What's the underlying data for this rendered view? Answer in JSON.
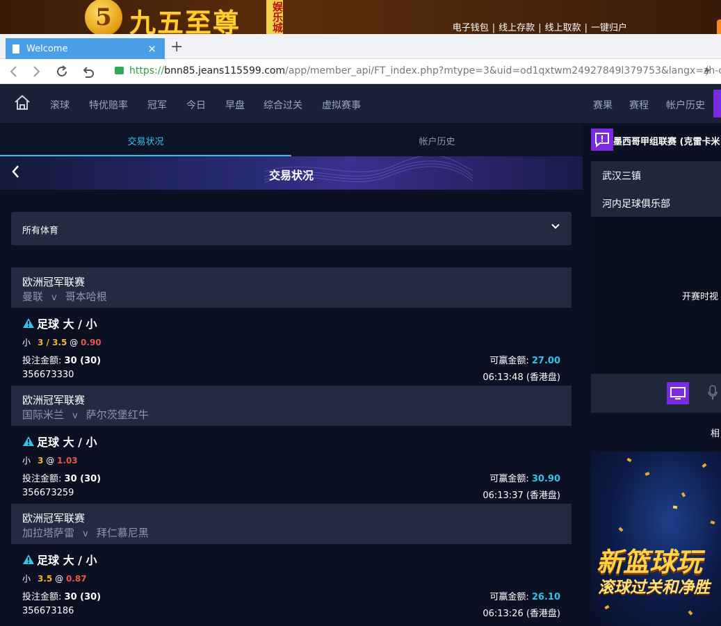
{
  "banner": {
    "logo_char": "5",
    "logo_text": "九五至尊",
    "logo_side": "娱乐城",
    "links": [
      "电子钱包",
      "线上存款",
      "线上取款",
      "一键归户"
    ],
    "separator": "|"
  },
  "browser": {
    "tab_title": "Welcome",
    "tab_close": "×",
    "new_tab": "+",
    "url_scheme": "https://",
    "url_host": "bnn85.jeans115599.com",
    "url_path": "/app/member_api/FT_index.php?mtype=3&uid=od1qxtwm24927849l379753&langx=zh-c"
  },
  "nav": {
    "items": [
      "滚球",
      "特优赔率",
      "冠军",
      "今日",
      "早盘",
      "综合过关",
      "虚拟赛事"
    ],
    "right_items": [
      "赛果",
      "赛程",
      "帐户历史"
    ]
  },
  "subtabs": {
    "active": "交易状况",
    "inactive": "帐户历史"
  },
  "page": {
    "back": "‹",
    "title": "交易状况"
  },
  "filter": {
    "label": "所有体育"
  },
  "bets": [
    {
      "league": "欧洲冠军联赛",
      "home": "曼联",
      "vs": "v",
      "away": "哥本哈根",
      "type": "足球 大 / 小",
      "side": "小",
      "handicap": "3 / 3.5",
      "at": "@",
      "odds": "0.90",
      "stake_label": "投注金额:",
      "stake": "30 (30)",
      "win_label": "可赢金额:",
      "win": "27.00",
      "ticket": "356673330",
      "time": "06:13:48 (香港盘)"
    },
    {
      "league": "欧洲冠军联赛",
      "home": "国际米兰",
      "vs": "v",
      "away": "萨尔茨堡红牛",
      "type": "足球 大 / 小",
      "side": "小",
      "handicap": "3",
      "at": "@",
      "odds": "1.03",
      "stake_label": "投注金额:",
      "stake": "30 (30)",
      "win_label": "可赢金额:",
      "win": "30.90",
      "ticket": "356673259",
      "time": "06:13:37 (香港盘)"
    },
    {
      "league": "欧洲冠军联赛",
      "home": "加拉塔萨雷",
      "vs": "v",
      "away": "拜仁慕尼黑",
      "type": "足球 大 / 小",
      "side": "小",
      "handicap": "3.5",
      "at": "@",
      "odds": "0.87",
      "stake_label": "投注金额:",
      "stake": "30 (30)",
      "win_label": "可赢金额:",
      "win": "26.10",
      "ticket": "356673186",
      "time": "06:13:26 (香港盘)"
    }
  ],
  "right_panel": {
    "league": "墨西哥甲组联赛 (克雷卡米",
    "team1": "武汉三镇",
    "team2": "河内足球俱乐部",
    "kickoff": "开赛时视",
    "related": "相",
    "promo_title": "新篮球玩",
    "promo_sub": "滚球过关和净胜"
  },
  "colors": {
    "accent_cyan": "#33c4e8",
    "accent_purple": "#7a2be0",
    "odds_red": "#e8584c",
    "handicap_gold": "#f3b331"
  }
}
